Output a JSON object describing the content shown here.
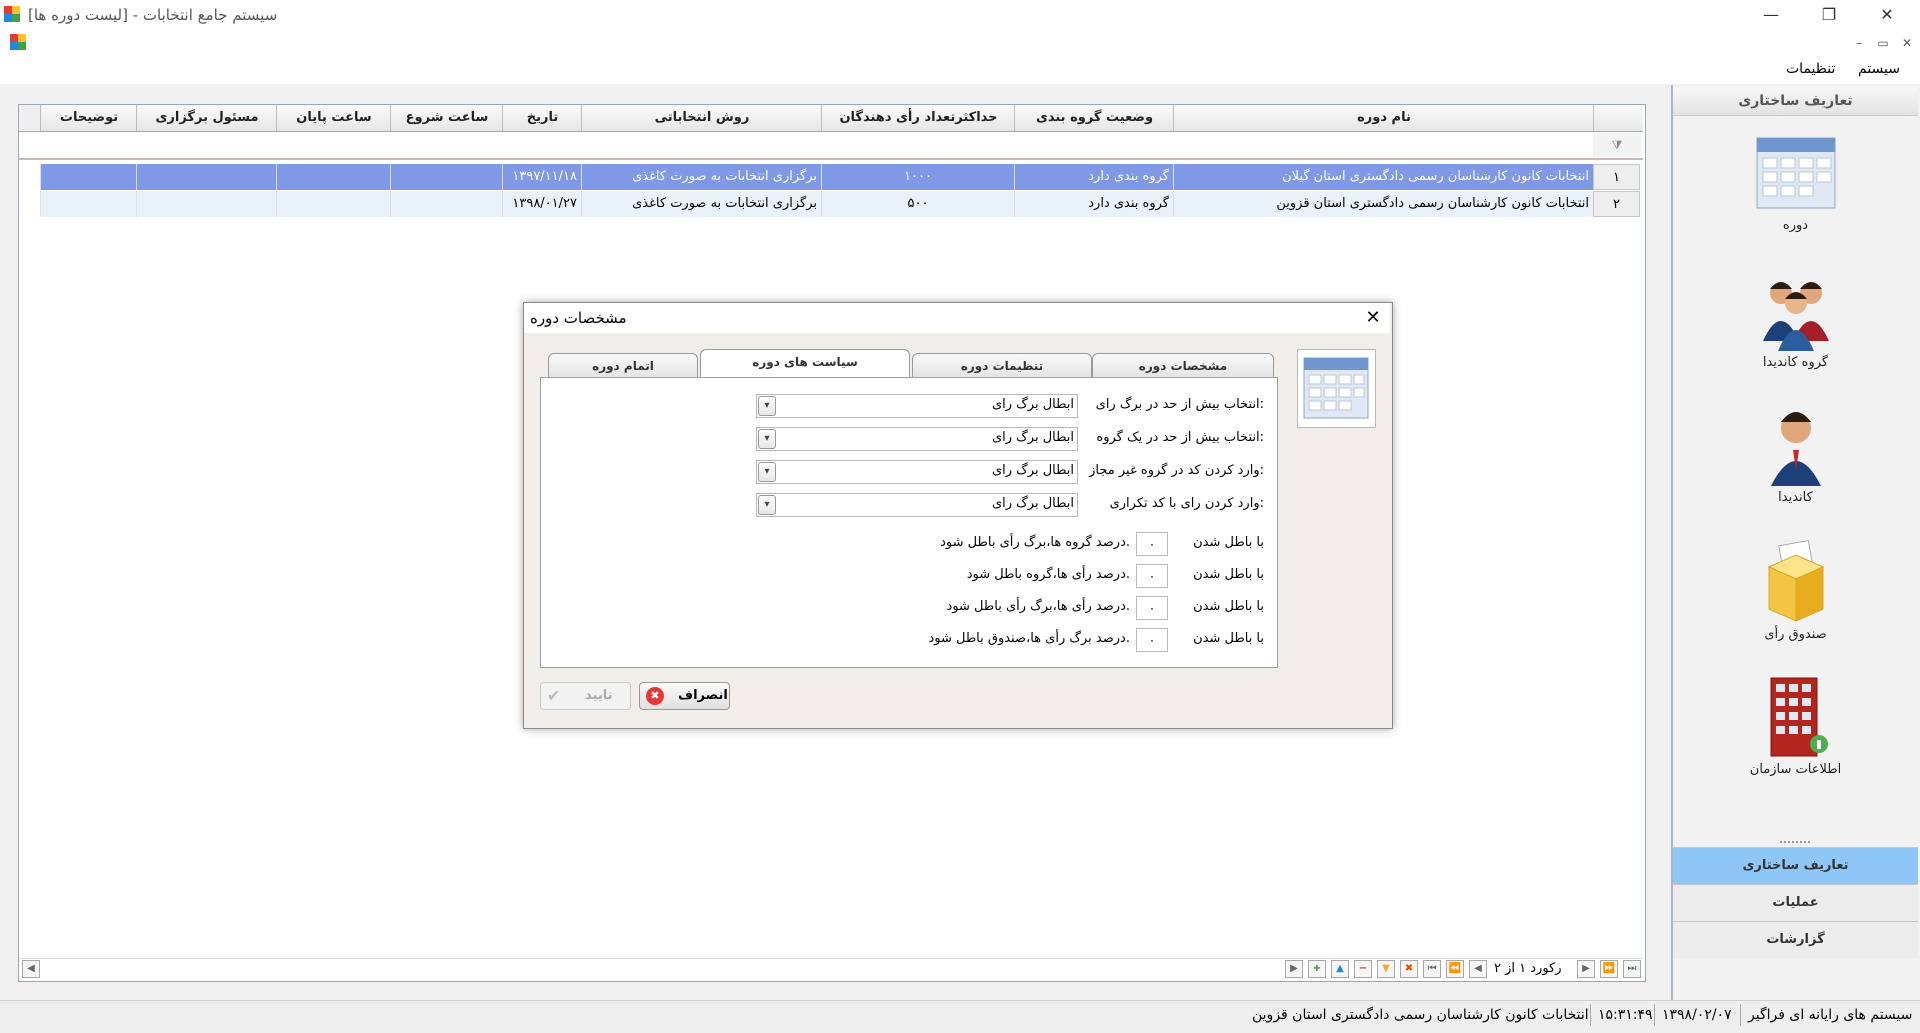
{
  "window": {
    "title": "سیستم جامع انتخابات - [لیست دوره ها]",
    "minimize_glyph": "—",
    "restore_glyph": "❐",
    "close_glyph": "✕"
  },
  "mdi": {
    "minimize_glyph": "–",
    "restore_glyph": "▭",
    "close_glyph": "✕"
  },
  "menu": {
    "items": [
      "سیستم",
      "تنظیمات"
    ]
  },
  "grid": {
    "columns": [
      "نام دوره",
      "وضعیت گروه بندی",
      "حداکثرتعداد رأی دهندگان",
      "روش انتخاباتی",
      "تاریخ",
      "ساعت شروع",
      "ساعت پایان",
      "مسئول برگزاری",
      "توضیحات"
    ],
    "filter_icon": "⧩",
    "rows": [
      {
        "num": "۱",
        "name": "انتخابات کانون کارشناسان رسمی دادگستری استان گیلان",
        "grouping": "گروه بندی دارد",
        "max_voters": "۱۰۰۰",
        "method": "برگزاری انتخابات به صورت کاغذی",
        "date": "۱۳۹۷/۱۱/۱۸",
        "start": "",
        "end": "",
        "responsible": "",
        "notes": "",
        "selected": true
      },
      {
        "num": "۲",
        "name": "انتخابات کانون کارشناسان رسمی دادگستری استان قزوین",
        "grouping": "گروه بندی دارد",
        "max_voters": "۵۰۰",
        "method": "برگزاری انتخابات به صورت کاغذی",
        "date": "۱۳۹۸/۰۱/۲۷",
        "start": "",
        "end": "",
        "responsible": "",
        "notes": "",
        "selected": false
      }
    ],
    "selected_color": "#8099e6",
    "alt_row_color": "#e9f2fb"
  },
  "navigator": {
    "record_text": "رکورد ۱ از ۲"
  },
  "right_panel": {
    "header": "تعاریف ساختاری",
    "tiles": [
      {
        "label": "دوره",
        "icon": "calendar-icon"
      },
      {
        "label": "گروه کاندیدا",
        "icon": "group-candidates-icon"
      },
      {
        "label": "کاندیدا",
        "icon": "candidate-icon"
      },
      {
        "label": "صندوق رأی",
        "icon": "ballot-box-icon"
      },
      {
        "label": "اطلاعات سازمان",
        "icon": "organization-icon"
      }
    ],
    "buttons": [
      "تعاریف ساختاری",
      "عملیات",
      "گزارشات"
    ],
    "active_color": "#8ec7f5"
  },
  "status": {
    "company": "سیستم های رایانه ای فراگیر",
    "date": "۱۳۹۸/۰۲/۰۷",
    "time": "۱۵:۳۱:۴۹",
    "election": "انتخابات کانون کارشناسان رسمی دادگستری استان قزوین"
  },
  "dialog": {
    "title": "مشخصات دوره",
    "close_glyph": "✕",
    "tabs": [
      "مشخصات دوره",
      "تنظیمات دوره",
      "سیاست های دوره",
      "اتمام دوره"
    ],
    "active_tab": 2,
    "policies": [
      {
        "label": "انتخاب بیش از حد در برگ رای:",
        "value": "ابطال برگ رای"
      },
      {
        "label": "انتخاب بیش از حد در یک گروه:",
        "value": "ابطال برگ رای"
      },
      {
        "label": "وارد کردن کد در گروه غیر مجاز:",
        "value": "ابطال برگ رای"
      },
      {
        "label": "وارد کردن رای با کد تکراری:",
        "value": "ابطال برگ رای"
      }
    ],
    "thresholds": [
      {
        "prefix": "با باطل شدن",
        "value": "۰",
        "suffix": "درصد گروه ها،برگ رأی باطل شود."
      },
      {
        "prefix": "با باطل شدن",
        "value": "۰",
        "suffix": "درصد رأی ها،گروه باطل شود."
      },
      {
        "prefix": "با باطل شدن",
        "value": "۰",
        "suffix": "درصد رأی ها،برگ رأی باطل شود."
      },
      {
        "prefix": "با باطل شدن",
        "value": "۰",
        "suffix": "درصد برگ رأی ها،صندوق باطل شود."
      }
    ],
    "cancel_label": "انصراف",
    "confirm_label": "تایید"
  }
}
